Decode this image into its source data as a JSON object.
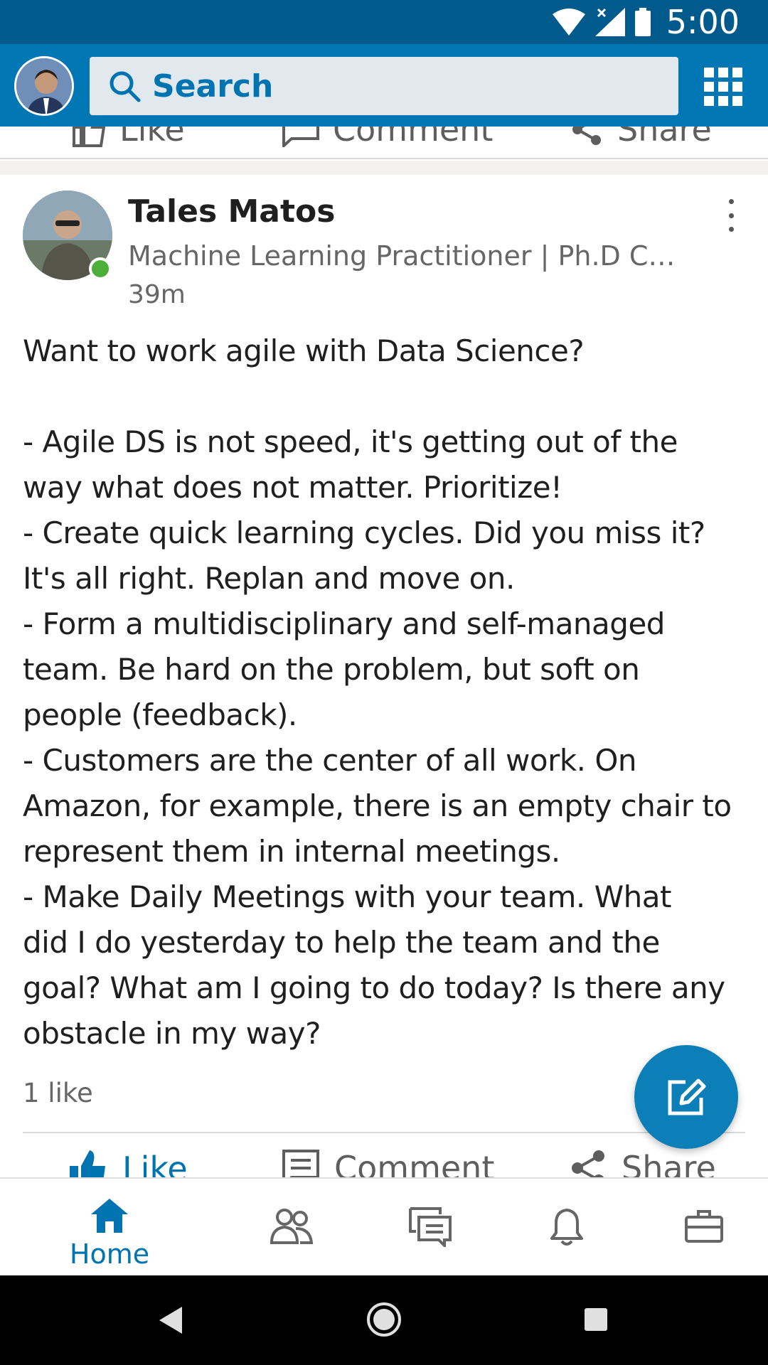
{
  "status_bar": {
    "time": "5:00"
  },
  "header": {
    "search_placeholder": "Search"
  },
  "previous_post": {
    "actions": [
      "Like",
      "Comment",
      "Share"
    ]
  },
  "post": {
    "author_name": "Tales Matos",
    "author_headline": "Machine Learning Practitioner | Ph.D Ca…",
    "time_ago": "39m",
    "body_lines": [
      "Want to work agile with Data Science?",
      "",
      "- Agile DS is not speed, it's getting out of the",
      "way what does not matter. Prioritize!",
      "- Create quick learning cycles. Did you miss it?",
      "It's all right. Replan and move on.",
      "- Form a multidisciplinary and self-managed",
      "team. Be hard on the problem, but soft on",
      "people (feedback).",
      "- Customers are the center of all work. On",
      "Amazon, for example, there is an empty chair to",
      "represent them in internal meetings.",
      "- Make Daily Meetings with your team. What",
      "did I do yesterday to help the team and the",
      "goal? What am I going to do today? Is there any",
      "obstacle in my way?"
    ],
    "likes_text": "1 like",
    "actions": {
      "like": "Like",
      "comment": "Comment",
      "share": "Share"
    }
  },
  "bottom_nav": {
    "items": [
      {
        "id": "home",
        "label": "Home",
        "icon": "home-icon",
        "active": true
      },
      {
        "id": "network",
        "label": "",
        "icon": "people-icon",
        "active": false
      },
      {
        "id": "messaging",
        "label": "",
        "icon": "messages-icon",
        "active": false
      },
      {
        "id": "notifications",
        "label": "",
        "icon": "bell-icon",
        "active": false
      },
      {
        "id": "jobs",
        "label": "",
        "icon": "briefcase-icon",
        "active": false
      }
    ]
  },
  "colors": {
    "status_bar": "#005a8c",
    "header": "#0077b5",
    "accent": "#0073b1",
    "online": "#4caf3a"
  }
}
